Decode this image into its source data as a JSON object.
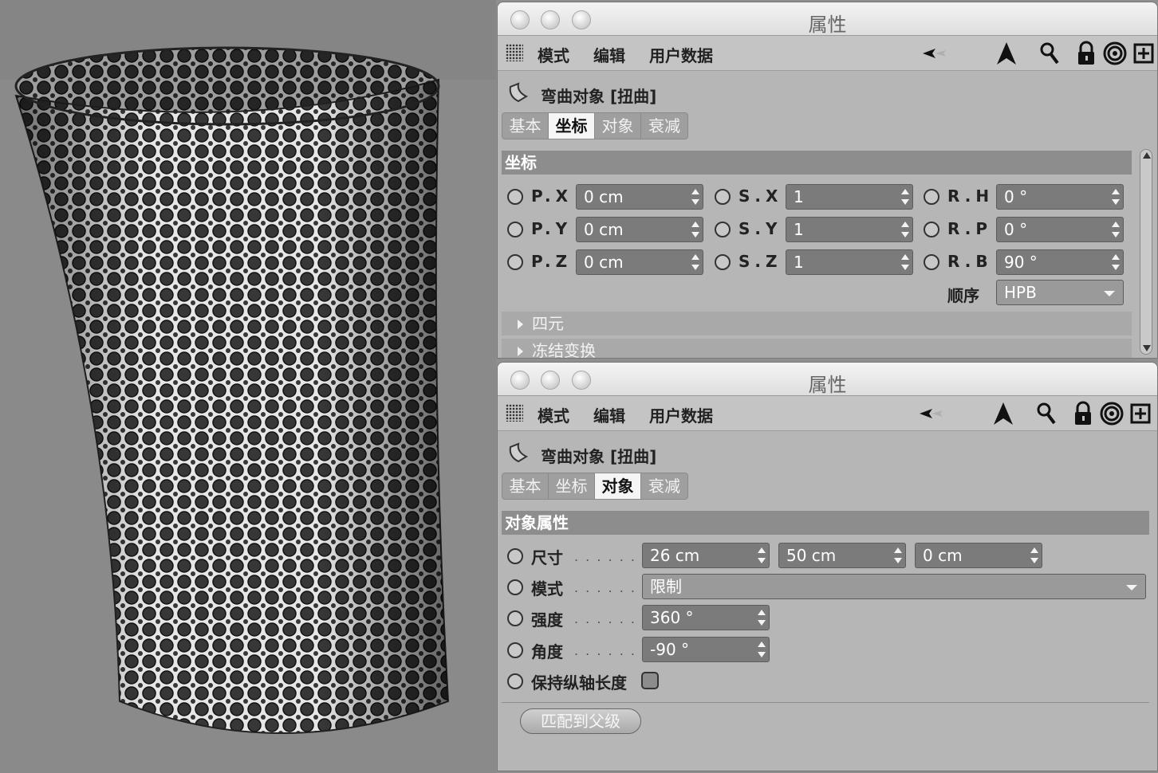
{
  "viewport": {
    "object": "perforated-cylinder"
  },
  "panel_top": {
    "title": "属性",
    "menu": [
      "模式",
      "编辑",
      "用户数据"
    ],
    "object_name": "弯曲对象 [扭曲]",
    "tabs": [
      "基本",
      "坐标",
      "对象",
      "衰减"
    ],
    "active_tab": "坐标",
    "section": "坐标",
    "coords": [
      {
        "label": "P.X",
        "value": "0 cm"
      },
      {
        "label": "P.Y",
        "value": "0 cm"
      },
      {
        "label": "P.Z",
        "value": "0 cm"
      },
      {
        "label": "S.X",
        "value": "1"
      },
      {
        "label": "S.Y",
        "value": "1"
      },
      {
        "label": "S.Z",
        "value": "1"
      },
      {
        "label": "R.H",
        "value": "0 °"
      },
      {
        "label": "R.P",
        "value": "0 °"
      },
      {
        "label": "R.B",
        "value": "90 °"
      }
    ],
    "order_label": "顺序",
    "order_value": "HPB",
    "collapsed": [
      "四元",
      "冻结变换"
    ]
  },
  "panel_bottom": {
    "title": "属性",
    "menu": [
      "模式",
      "编辑",
      "用户数据"
    ],
    "object_name": "弯曲对象 [扭曲]",
    "tabs": [
      "基本",
      "坐标",
      "对象",
      "衰减"
    ],
    "active_tab": "对象",
    "section": "对象属性",
    "size_label": "尺寸",
    "size_values": [
      "26 cm",
      "50 cm",
      "0 cm"
    ],
    "mode_label": "模式",
    "mode_value": "限制",
    "strength_label": "强度",
    "strength_value": "360 °",
    "angle_label": "角度",
    "angle_value": "-90 °",
    "keep_length_label": "保持纵轴长度",
    "keep_length_checked": false,
    "fit_button": "匹配到父级"
  },
  "icons": [
    "back-arrow-icon",
    "cursor-arrow-icon",
    "search-icon",
    "lock-icon",
    "target-icon",
    "new-panel-icon"
  ]
}
